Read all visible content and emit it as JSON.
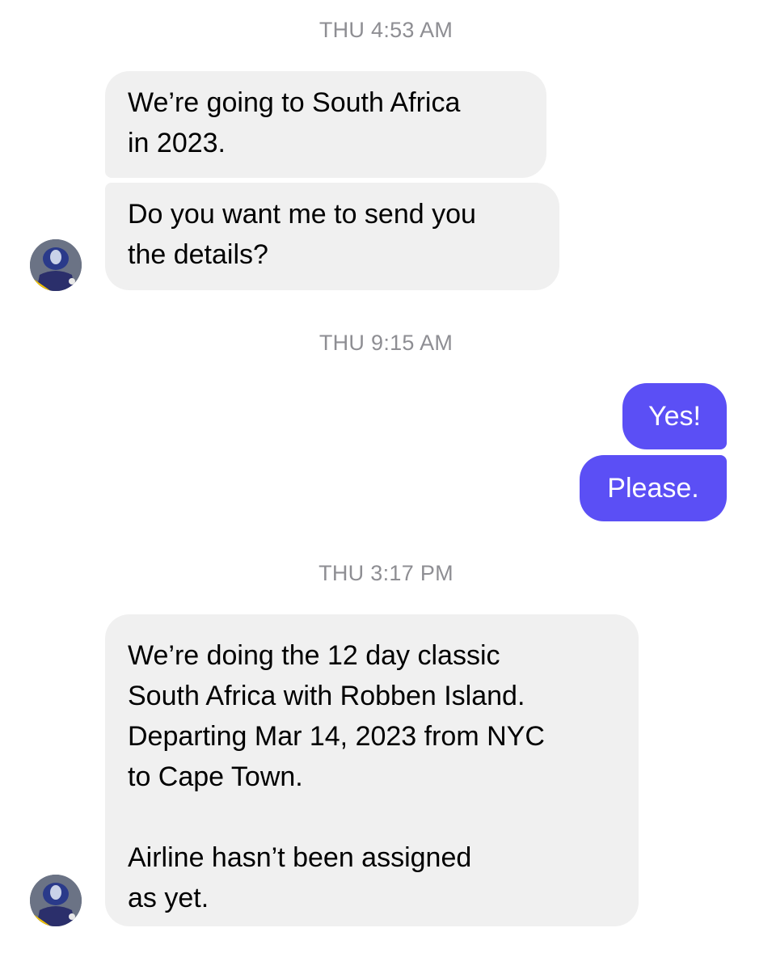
{
  "conversation": {
    "timestamp_1": "THU 4:53 AM",
    "timestamp_2": "THU 9:15 AM",
    "timestamp_3": "THU 3:17 PM",
    "messages": [
      {
        "direction": "incoming",
        "text": "We’re going to South Africa\nin 2023."
      },
      {
        "direction": "incoming",
        "text": "Do you want me to send you\nthe details?"
      },
      {
        "direction": "outgoing",
        "text": "Yes!"
      },
      {
        "direction": "outgoing",
        "text": "Please."
      },
      {
        "direction": "incoming",
        "text": "We’re doing the 12 day classic\nSouth Africa with Robben Island.\nDeparting Mar 14, 2023 from NYC\nto Cape Town.\n\nAirline hasn’t been assigned\nas yet."
      }
    ]
  },
  "colors": {
    "incoming_bubble": "#f0f0f0",
    "outgoing_bubble": "#5b4ff5",
    "timestamp": "#8e8e93"
  },
  "icons": {
    "avatar": "contact-avatar-icon"
  }
}
